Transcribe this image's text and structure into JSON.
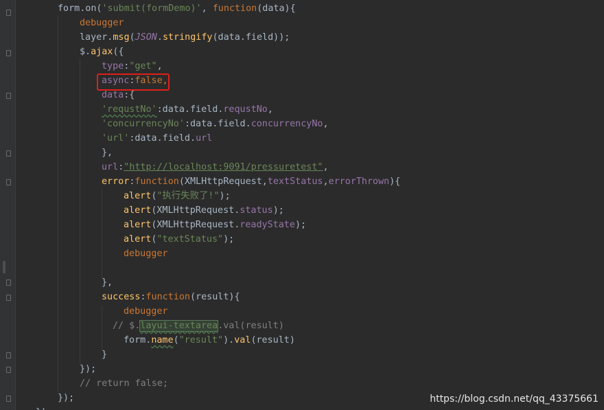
{
  "editor": {
    "lines": [
      {
        "indent": 84,
        "tokens": [
          [
            "plain",
            "form.on("
          ],
          [
            "str",
            "'submit(formDemo)'"
          ],
          [
            "plain",
            ", "
          ],
          [
            "kw",
            "function"
          ],
          [
            "plain",
            "(data){"
          ]
        ]
      },
      {
        "indent": 116,
        "tokens": [
          [
            "kw",
            "debugger"
          ]
        ]
      },
      {
        "indent": 116,
        "tokens": [
          [
            "plain",
            "layer."
          ],
          [
            "fn",
            "msg"
          ],
          [
            "plain",
            "("
          ],
          [
            "prop italic",
            "JSON"
          ],
          [
            "plain",
            "."
          ],
          [
            "fn",
            "stringify"
          ],
          [
            "plain",
            "(data.field));"
          ]
        ]
      },
      {
        "indent": 116,
        "tokens": [
          [
            "plain",
            "$."
          ],
          [
            "fn",
            "ajax"
          ],
          [
            "plain",
            "({"
          ]
        ]
      },
      {
        "indent": 148,
        "tokens": [
          [
            "prop",
            "type"
          ],
          [
            "plain",
            ":"
          ],
          [
            "str",
            "\"get\""
          ],
          [
            "plain",
            ","
          ]
        ]
      },
      {
        "indent": 148,
        "tokens": [
          [
            "prop",
            "async"
          ],
          [
            "plain",
            ":"
          ],
          [
            "kw",
            "false,"
          ]
        ]
      },
      {
        "indent": 148,
        "tokens": [
          [
            "prop",
            "data"
          ],
          [
            "plain",
            ":{"
          ]
        ]
      },
      {
        "indent": 148,
        "tokens": [
          [
            "str typo",
            "'requstNo'"
          ],
          [
            "plain",
            ":data.field."
          ],
          [
            "prop",
            "requstNo"
          ],
          [
            "plain",
            ","
          ]
        ]
      },
      {
        "indent": 148,
        "tokens": [
          [
            "str",
            "'concurrencyNo'"
          ],
          [
            "plain",
            ":data.field."
          ],
          [
            "prop",
            "concurrencyNo"
          ],
          [
            "plain",
            ","
          ]
        ]
      },
      {
        "indent": 148,
        "tokens": [
          [
            "str",
            "'url'"
          ],
          [
            "plain",
            ":data.field."
          ],
          [
            "prop",
            "url"
          ]
        ]
      },
      {
        "indent": 148,
        "tokens": [
          [
            "plain",
            "},"
          ]
        ]
      },
      {
        "indent": 148,
        "tokens": [
          [
            "prop",
            "url"
          ],
          [
            "plain",
            ":"
          ],
          [
            "url",
            "\"http://localhost:9091/pressuretest\""
          ],
          [
            "plain",
            ","
          ]
        ]
      },
      {
        "indent": 148,
        "tokens": [
          [
            "fn",
            "error"
          ],
          [
            "plain",
            ":"
          ],
          [
            "kw",
            "function"
          ],
          [
            "plain",
            "(XMLHttpRequest,"
          ],
          [
            "prop",
            "textStatus"
          ],
          [
            "plain",
            ","
          ],
          [
            "prop",
            "errorThrown"
          ],
          [
            "plain",
            "){"
          ]
        ]
      },
      {
        "indent": 180,
        "tokens": [
          [
            "fn",
            "alert"
          ],
          [
            "plain",
            "("
          ],
          [
            "str",
            "\"执行失败了!\""
          ],
          [
            "plain",
            ");"
          ]
        ]
      },
      {
        "indent": 180,
        "tokens": [
          [
            "fn",
            "alert"
          ],
          [
            "plain",
            "(XMLHttpRequest."
          ],
          [
            "prop",
            "status"
          ],
          [
            "plain",
            ");"
          ]
        ]
      },
      {
        "indent": 180,
        "tokens": [
          [
            "fn",
            "alert"
          ],
          [
            "plain",
            "(XMLHttpRequest."
          ],
          [
            "prop",
            "readyState"
          ],
          [
            "plain",
            ");"
          ]
        ]
      },
      {
        "indent": 180,
        "tokens": [
          [
            "fn",
            "alert"
          ],
          [
            "plain",
            "("
          ],
          [
            "str",
            "\"textStatus\""
          ],
          [
            "plain",
            ");"
          ]
        ]
      },
      {
        "indent": 180,
        "tokens": [
          [
            "kw",
            "debugger"
          ]
        ]
      },
      {
        "indent": 180,
        "tokens": []
      },
      {
        "indent": 148,
        "tokens": [
          [
            "plain",
            "},"
          ]
        ]
      },
      {
        "indent": 148,
        "tokens": [
          [
            "fn",
            "success"
          ],
          [
            "plain",
            ":"
          ],
          [
            "kw",
            "function"
          ],
          [
            "plain",
            "(result){"
          ]
        ]
      },
      {
        "indent": 180,
        "tokens": [
          [
            "kw",
            "debugger"
          ]
        ]
      },
      {
        "indent": 164,
        "tokens": [
          [
            "cmt",
            "// $."
          ],
          [
            "str typo sel-word",
            "layui-textarea"
          ],
          [
            "cmt",
            ".val(result)"
          ]
        ]
      },
      {
        "indent": 180,
        "tokens": [
          [
            "plain",
            "form."
          ],
          [
            "fn typo",
            "name"
          ],
          [
            "plain",
            "("
          ],
          [
            "str",
            "\"result\""
          ],
          [
            "plain",
            ")."
          ],
          [
            "fn",
            "val"
          ],
          [
            "plain",
            "(result)"
          ]
        ]
      },
      {
        "indent": 148,
        "tokens": [
          [
            "plain",
            "}"
          ]
        ]
      },
      {
        "indent": 116,
        "tokens": [
          [
            "plain",
            "});"
          ]
        ]
      },
      {
        "indent": 116,
        "tokens": [
          [
            "cmt",
            "// return false;"
          ]
        ]
      },
      {
        "indent": 84,
        "tokens": [
          [
            "plain",
            "});"
          ]
        ]
      },
      {
        "indent": 52,
        "tokens": [
          [
            "plain",
            "});"
          ]
        ]
      }
    ]
  },
  "watermark": "https://blog.csdn.net/qq_43375661",
  "colors": {
    "background": "#2b2b2b",
    "keyword": "#cc7832",
    "function": "#ffc66d",
    "string": "#6a8759",
    "property": "#9876aa",
    "text": "#a9b7c6",
    "comment": "#808080",
    "highlight_box": "#e0201a"
  }
}
